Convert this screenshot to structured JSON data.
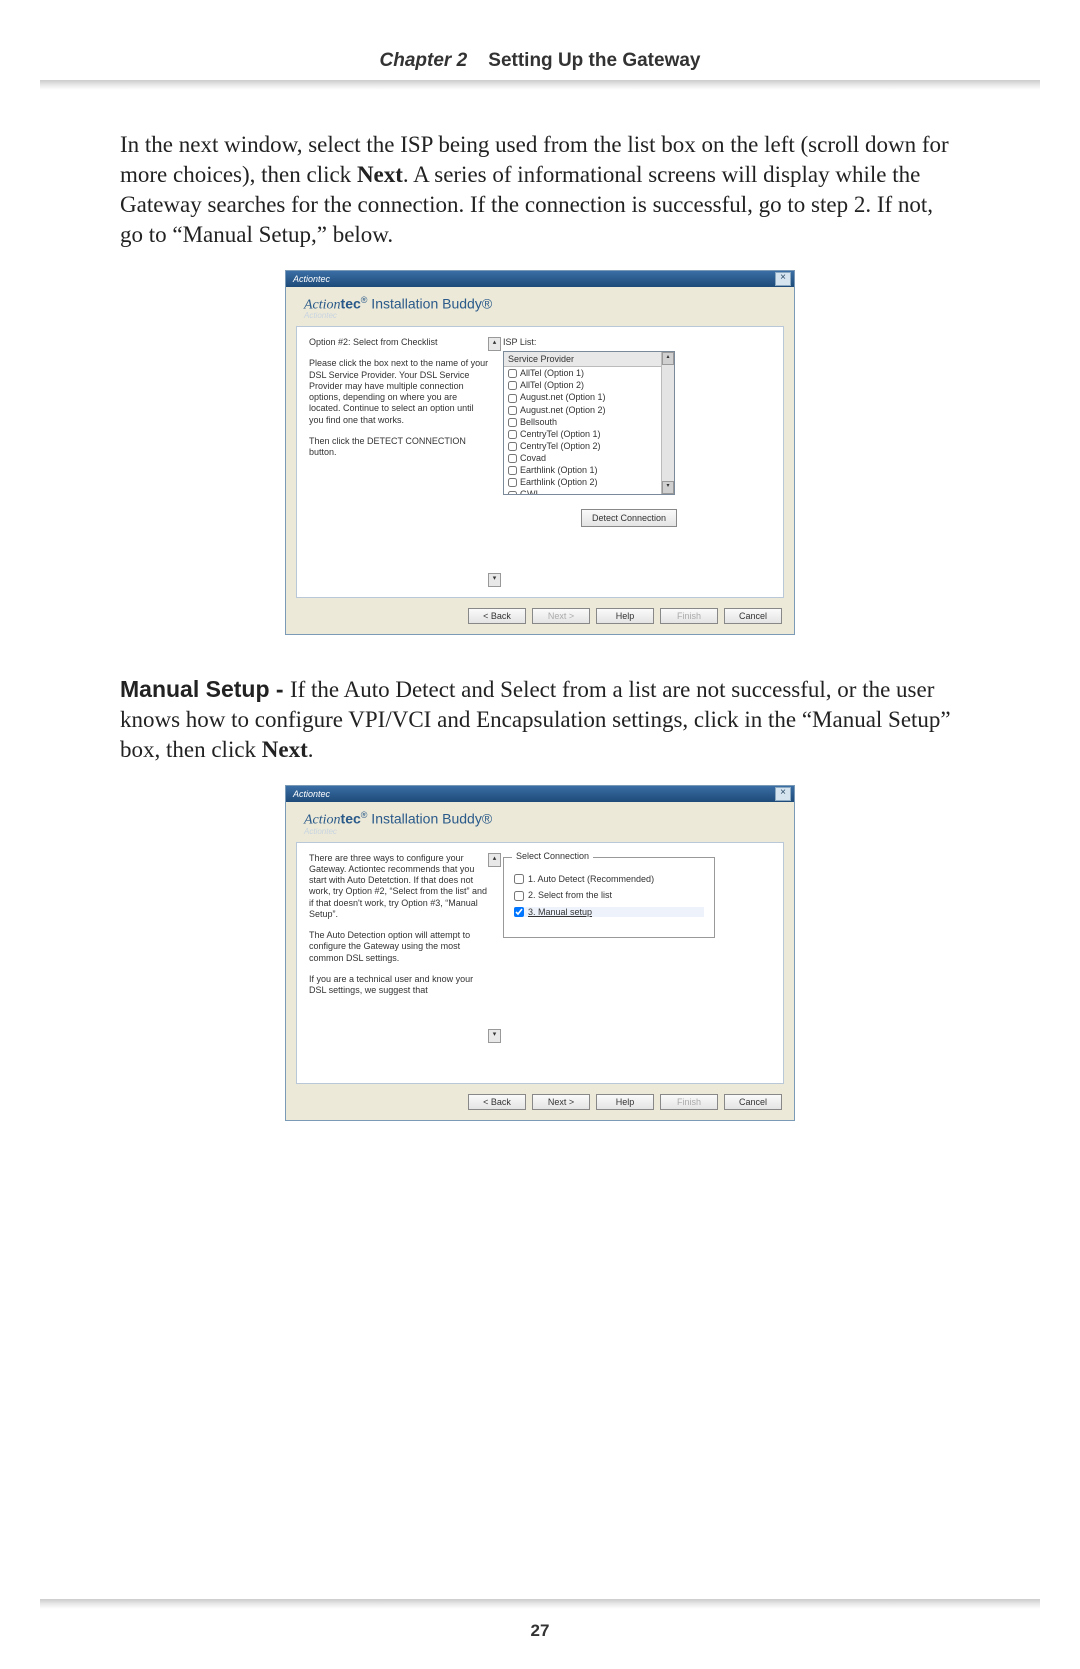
{
  "header": {
    "chapter": "Chapter 2",
    "title": "Setting Up the Gateway"
  },
  "para1_pre": "In the next window, select the ",
  "para1_isp": "ISP",
  "para1_mid": " being used from the list box on the left (scroll down for more choices), then click ",
  "para1_next": "Next",
  "para1_post": ". A series of informational screens will display while the Gateway searches for the connection. If the connection is successful, go to step 2. If not, go to “Manual Setup,” below.",
  "manual_label": "Manual Setup - ",
  "para2_a": "If the Auto Detect and Select from a list are not successful, or the user knows how to configure ",
  "para2_vpi": "VPI",
  "para2_slash": "/",
  "para2_vci": "VCI",
  "para2_b": " and Encapsulation settings, click in the “Manual Setup” box, then click ",
  "para2_next": "Next",
  "para2_c": ".",
  "pagenum": "27",
  "win": {
    "titlebar": "Actiontec",
    "close": "×",
    "brand_action": "Action",
    "brand_tec": "tec",
    "brand_reg": "®",
    "brand_suffix": " Installation Buddy®",
    "brand_shadow": "Actiontec"
  },
  "win1": {
    "hdr": "Option #2: Select from Checklist",
    "p1": "Please click the box next to the name of your DSL Service Provider. Your DSL Service Provider may have multiple connection options, depending on where you are located. Continue to select an option until you find one that works.",
    "p2": "Then click the DETECT CONNECTION button.",
    "isp_label": "ISP List:",
    "list_header": "Service Provider",
    "items": [
      "AllTel (Option 1)",
      "AllTel (Option 2)",
      "August.net (Option 1)",
      "August.net (Option 2)",
      "Bellsouth",
      "CentryTel (Option 1)",
      "CentryTel (Option 2)",
      "Covad",
      "Earthlink (Option 1)",
      "Earthlink (Option 2)",
      "GWI"
    ],
    "detect": "Detect Connection"
  },
  "win2": {
    "p1": "There are three ways to configure your Gateway. Actiontec recommends that you start with Auto Detetction. If that does not work, try Option #2, “Select from the list” and if that doesn't work, try Option #3, “Manual Setup”.",
    "p2": "The Auto Detection option will attempt to configure the Gateway using the most common DSL settings.",
    "p3": "If you are a technical user and know your DSL settings, we suggest that",
    "legend": "Select Connection",
    "opt1": "1. Auto Detect (Recommended)",
    "opt2": "2. Select from the list",
    "opt3": "3. Manual setup"
  },
  "buttons": {
    "back": "< Back",
    "next": "Next >",
    "help": "Help",
    "finish": "Finish",
    "cancel": "Cancel"
  }
}
